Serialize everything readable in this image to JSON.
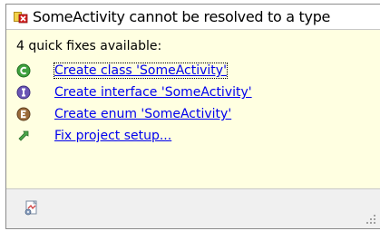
{
  "header": {
    "title": "SomeActivity cannot be resolved to a type",
    "icon": "error-marker-icon"
  },
  "body": {
    "summary": "4 quick fixes available:",
    "fixes": [
      {
        "label": "Create class 'SomeActivity'",
        "icon": "class-icon",
        "color": "#2e8b2e"
      },
      {
        "label": "Create interface 'SomeActivity'",
        "icon": "interface-icon",
        "color": "#5a4aa0"
      },
      {
        "label": "Create enum 'SomeActivity'",
        "icon": "enum-icon",
        "color": "#8b5a2b"
      },
      {
        "label": "Fix project setup...",
        "icon": "fix-setup-icon",
        "color": "#3a9a3a"
      }
    ]
  },
  "footer": {
    "icon": "configure-problem-severity-icon"
  },
  "colors": {
    "link": "#0000ee",
    "body_bg": "#ffffe1",
    "footer_bg": "#f0f0f0"
  }
}
